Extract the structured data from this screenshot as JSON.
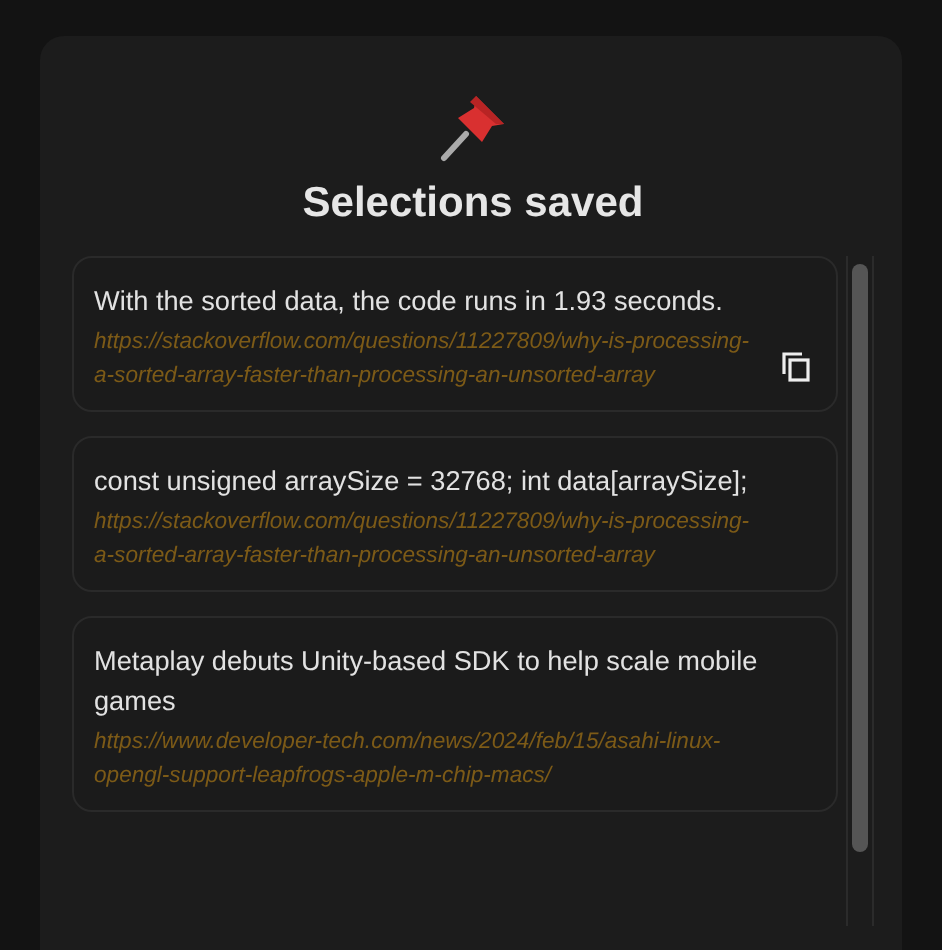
{
  "title": "Selections saved",
  "selections": [
    {
      "text": "With the sorted data, the code runs in 1.93 seconds.",
      "url": "https://stackoverflow.com/questions/11227809/why-is-processing-a-sorted-array-faster-than-processing-an-unsorted-array",
      "hovered": true
    },
    {
      "text": "const unsigned arraySize = 32768; int data[arraySize];",
      "url": "https://stackoverflow.com/questions/11227809/why-is-processing-a-sorted-array-faster-than-processing-an-unsorted-array",
      "hovered": false
    },
    {
      "text": "Metaplay debuts Unity-based SDK to help scale mobile games",
      "url": "https://www.developer-tech.com/news/2024/feb/15/asahi-linux-opengl-support-leapfrogs-apple-m-chip-macs/",
      "hovered": false
    }
  ]
}
